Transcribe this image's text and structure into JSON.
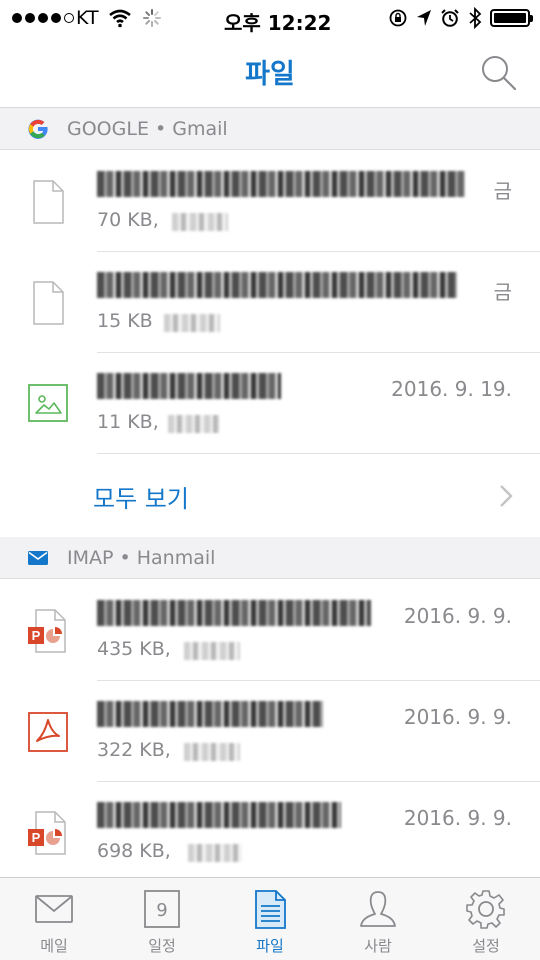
{
  "status_bar": {
    "carrier": "KT",
    "time": "오후 12:22"
  },
  "nav": {
    "title": "파일",
    "search_icon": "search-icon"
  },
  "sections": [
    {
      "header": "GOOGLE • Gmail",
      "icon": "google-icon",
      "files": [
        {
          "icon": "document-icon",
          "size": "70 KB,",
          "date": "금"
        },
        {
          "icon": "document-icon",
          "size": "15 KB",
          "date": "금"
        },
        {
          "icon": "image-icon",
          "size": "11 KB,",
          "date": "2016. 9. 19."
        }
      ],
      "see_all": "모두 보기"
    },
    {
      "header": "IMAP • Hanmail",
      "icon": "mail-icon",
      "files": [
        {
          "icon": "powerpoint-icon",
          "size": "435 KB,",
          "date": "2016. 9. 9."
        },
        {
          "icon": "pdf-icon",
          "size": "322 KB,",
          "date": "2016. 9. 9."
        },
        {
          "icon": "powerpoint-icon",
          "size": "698 KB,",
          "date": "2016. 9. 9."
        }
      ]
    }
  ],
  "tabs": [
    {
      "label": "메일",
      "icon": "mail-icon",
      "active": false
    },
    {
      "label": "일정",
      "icon": "calendar-icon",
      "calendar_day": "9",
      "active": false
    },
    {
      "label": "파일",
      "icon": "files-icon",
      "active": true
    },
    {
      "label": "사람",
      "icon": "person-icon",
      "active": false
    },
    {
      "label": "설정",
      "icon": "gear-icon",
      "active": false
    }
  ],
  "colors": {
    "accent": "#1477c9",
    "secondary_text": "#8a8a8e",
    "image_icon": "#5cb85c",
    "office_red": "#d9472b"
  }
}
